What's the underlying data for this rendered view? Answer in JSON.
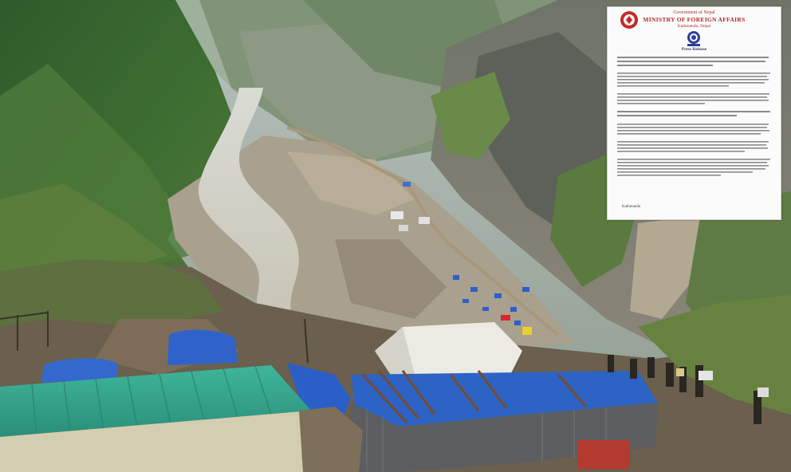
{
  "image": {
    "description_free": true
  },
  "document": {
    "gov_line": "Government of Nepal",
    "ministry": "MINISTRY OF FOREIGN AFFAIRS",
    "place": "Kathmandu, Nepal",
    "press_release": "Press Release",
    "signatory_place": "Kathmandu",
    "colors": {
      "header": "#b02a2a",
      "text": "#6a6a6a"
    }
  }
}
